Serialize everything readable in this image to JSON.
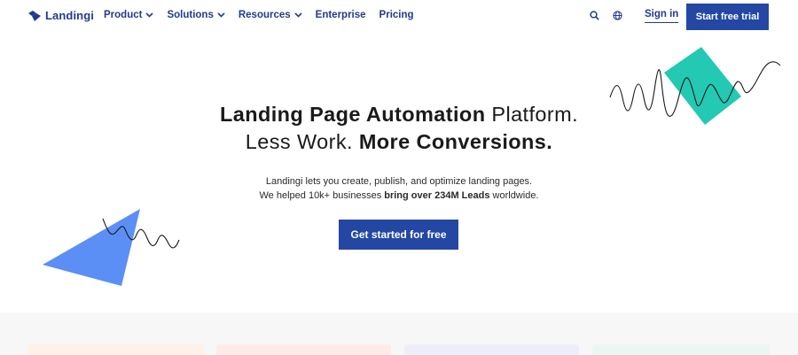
{
  "nav": {
    "logo_text": "Landingi",
    "menu": [
      {
        "label": "Product",
        "dropdown": true
      },
      {
        "label": "Solutions",
        "dropdown": true
      },
      {
        "label": "Resources",
        "dropdown": true
      },
      {
        "label": "Enterprise",
        "dropdown": false
      },
      {
        "label": "Pricing",
        "dropdown": false
      }
    ],
    "search_icon": "search-icon",
    "language_icon": "globe-icon",
    "signin_label": "Sign in",
    "trial_label": "Start free trial"
  },
  "hero": {
    "line1_bold": "Landing Page Automation",
    "line1_light": " Platform.",
    "line2_light": "Less Work. ",
    "line2_bold": "More Conversions.",
    "sub1": "Landingi lets you create, publish, and optimize landing pages.",
    "sub2_pre": "We helped 10k+ businesses ",
    "sub2_bold": "bring over 234M Leads",
    "sub2_post": " worldwide.",
    "cta_label": "Get started for free"
  },
  "colors": {
    "brand_navy": "#213b8f",
    "button_blue": "#2447a4",
    "teal": "#23c9b2",
    "triangle_blue": "#5b8ff5",
    "bottom_bg": "#f7f7f8",
    "card_peach": "#fdf1e8",
    "card_pink": "#fdebea",
    "card_lavender": "#eeeefb",
    "card_mint": "#e9f7f0"
  }
}
